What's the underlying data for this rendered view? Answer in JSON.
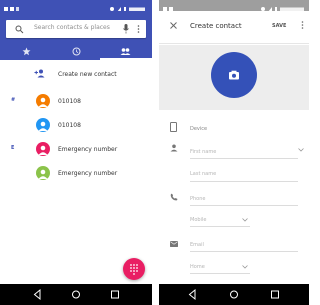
{
  "contacts_screen": {
    "search": {
      "placeholder": "Search contacts & places"
    },
    "tabs": [
      {
        "icon": "star-icon"
      },
      {
        "icon": "clock-icon"
      },
      {
        "icon": "people-icon"
      }
    ],
    "create_contact_label": "Create new contact",
    "contacts": [
      {
        "name": "010108",
        "letter": "#",
        "color": "#f57c00",
        "show_letter": true
      },
      {
        "name": "010108",
        "letter": "",
        "color": "#2196f3",
        "show_letter": false
      },
      {
        "name": "Emergency number",
        "letter": "E",
        "color": "#e91e63",
        "show_letter": true
      },
      {
        "name": "Emergency number",
        "letter": "",
        "color": "#8bc34a",
        "show_letter": false
      }
    ],
    "fab": {
      "icon": "dialpad-icon",
      "color": "#e91e63"
    }
  },
  "create_contact_screen": {
    "title": "Create contact",
    "save_label": "SAVE",
    "account": "Device",
    "fields": {
      "first_name": "First name",
      "last_name": "Last name",
      "phone": "Phone",
      "phone_type": "Mobile",
      "email": "Email",
      "email_type": "Home"
    },
    "photo_color": "#3451b8"
  },
  "colors": {
    "primary": "#3f51b5",
    "accent": "#e91e63",
    "navbar": "#000000"
  }
}
